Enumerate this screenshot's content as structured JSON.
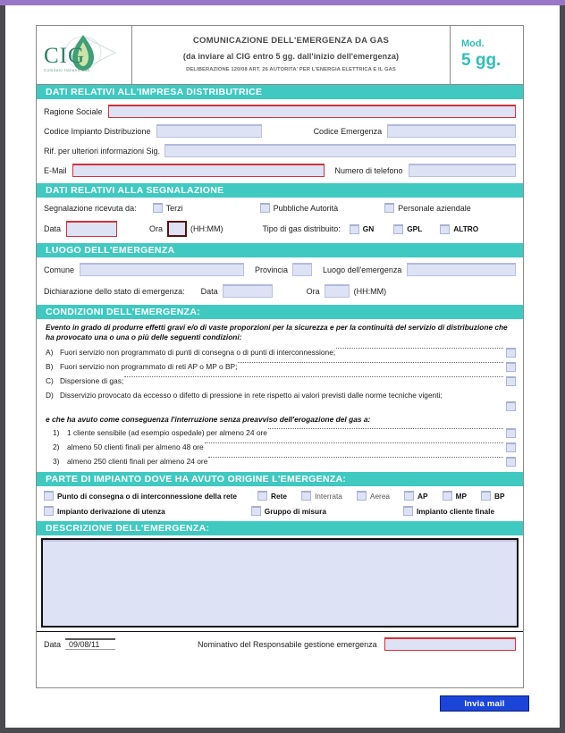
{
  "header": {
    "logo_name": "CIG",
    "logo_sub": "Comitato Italiano Gas",
    "title_line1": "COMUNICAZIONE DELL'EMERGENZA DA GAS",
    "title_line2": "(da inviare al CIG entro 5 gg. dall'inizio dell'emergenza)",
    "title_line3": "DELIBERAZIONE 120/08 ART. 26 AUTORITA' PER L'ENERGIA ELETTRICA E IL GAS",
    "mod_label": "Mod.",
    "mod_value": "5 gg.",
    "teal": "#3fc9c1"
  },
  "section_distributrice": {
    "bar": "DATI RELATIVI ALL'IMPRESA DISTRIBUTRICE",
    "ragione_sociale_label": "Ragione Sociale",
    "ragione_sociale_value": "",
    "codice_impianto_label": "Codice Impianto Distribuzione",
    "codice_impianto_value": "",
    "codice_emergenza_label": "Codice Emergenza",
    "codice_emergenza_value": "",
    "riferimento_label": "Rif. per ulteriori informazioni Sig.",
    "riferimento_value": "",
    "email_label": "E-Mail",
    "email_value": "",
    "telefono_label": "Numero di telefono",
    "telefono_value": ""
  },
  "section_segnalazione": {
    "bar": "DATI RELATIVI ALLA SEGNALAZIONE",
    "ricevuta_label": "Segnalazione ricevuta da:",
    "sources": [
      {
        "label": "Terzi",
        "checked": false
      },
      {
        "label": "Pubbliche Autorità",
        "checked": false
      },
      {
        "label": "Personale aziendale",
        "checked": false
      }
    ],
    "data_label": "Data",
    "data_value": "",
    "ora_label": "Ora",
    "ora_value": "",
    "hhmm": "(HH:MM)",
    "tipo_gas_label": "Tipo di gas distribuito:",
    "gas_types": [
      {
        "label": "GN",
        "checked": false
      },
      {
        "label": "GPL",
        "checked": false
      },
      {
        "label": "ALTRO",
        "checked": false
      }
    ]
  },
  "section_luogo": {
    "bar": "LUOGO DELL'EMERGENZA",
    "comune_label": "Comune",
    "comune_value": "",
    "provincia_label": "Provincia",
    "provincia_value": "",
    "luogo_label": "Luogo dell'emergenza",
    "luogo_value": "",
    "dichiarazione_label": "Dichiarazione dello stato di emergenza:",
    "data_label": "Data",
    "data_value": "",
    "ora_label": "Ora",
    "ora_value": "",
    "hhmm": "(HH:MM)"
  },
  "section_condizioni": {
    "bar": "CONDIZIONI DELL'EMERGENZA:",
    "intro": "Evento in grado di produrre effetti gravi e/o di vaste proporzioni per la sicurezza e per la continuità del servizio di distribuzione che ha provocato una o una o più delle seguenti condizioni:",
    "conditions": [
      {
        "key": "A)",
        "text": "Fuori servizio non programmato di punti di consegna o di punti di interconnessione;",
        "checked": false
      },
      {
        "key": "B)",
        "text": "Fuori servizio non programmato di reti AP o MP o BP;",
        "checked": false
      },
      {
        "key": "C)",
        "text": "Dispersione di gas;",
        "checked": false
      },
      {
        "key": "D)",
        "text": "Disservizio provocato da eccesso o difetto di pressione in rete rispetto ai valori previsti dalle norme tecniche vigenti;",
        "checked": false
      }
    ],
    "mid_note": "e che ha avuto come conseguenza l'interruzione senza preavviso dell'erogazione del gas a:",
    "consequences": [
      {
        "key": "1)",
        "text": "1 cliente sensibile (ad esempio ospedale) per almeno 24 ore",
        "checked": false
      },
      {
        "key": "2)",
        "text": "almeno 50 clienti finali per almeno 48 ore",
        "checked": false
      },
      {
        "key": "3)",
        "text": "almeno 250 clienti finali per almeno 24 ore",
        "checked": false
      }
    ]
  },
  "section_parte_impianto": {
    "bar": "PARTE DI IMPIANTO DOVE HA AVUTO ORIGINE L'EMERGENZA:",
    "row1": [
      {
        "label": "Punto di consegna o di interconnessione della rete",
        "checked": false,
        "bold": true
      },
      {
        "label": "Rete",
        "checked": false,
        "bold": true
      },
      {
        "label": "Interrata",
        "checked": false,
        "bold": false
      },
      {
        "label": "Aerea",
        "checked": false,
        "bold": false
      },
      {
        "label": "AP",
        "checked": false,
        "bold": true
      },
      {
        "label": "MP",
        "checked": false,
        "bold": true
      },
      {
        "label": "BP",
        "checked": false,
        "bold": true
      }
    ],
    "row2": [
      {
        "label": "Impianto derivazione di utenza",
        "checked": false,
        "bold": true
      },
      {
        "label": "Gruppo di misura",
        "checked": false,
        "bold": true
      },
      {
        "label": "Impianto cliente finale",
        "checked": false,
        "bold": true
      }
    ]
  },
  "section_descrizione": {
    "bar": "DESCRIZIONE DELL'EMERGENZA:",
    "value": ""
  },
  "footer": {
    "data_label": "Data",
    "data_value": "09/08/11",
    "responsabile_label": "Nominativo del Responsabile gestione emergenza",
    "responsabile_value": "",
    "send_label": "Invia mail",
    "send_color": "#1b45d8"
  }
}
